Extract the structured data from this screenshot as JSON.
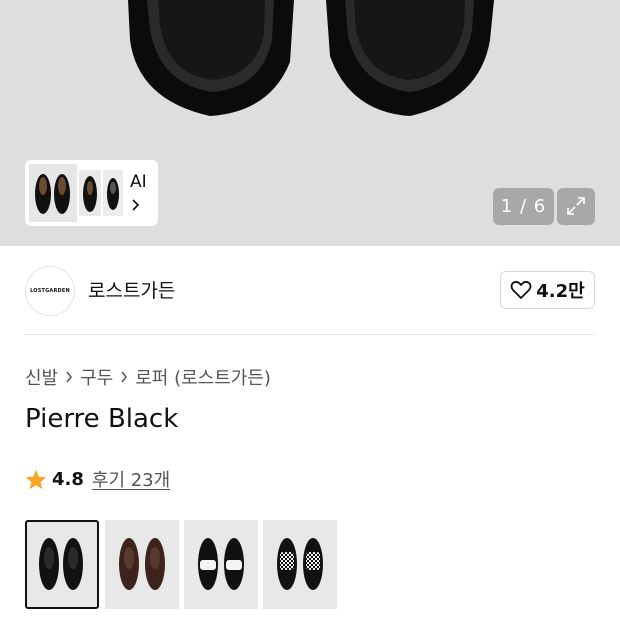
{
  "gallery": {
    "ai_label": "AI",
    "counter": "1 / 6"
  },
  "brand": {
    "logo_text": "LOSTGARDEN",
    "name": "로스트가든",
    "like_count": "4.2만"
  },
  "breadcrumb": [
    "신발",
    "구두",
    "로퍼 (로스트가든)"
  ],
  "product": {
    "title": "Pierre Black",
    "rating": "4.8",
    "reviews_label": "후기 23개"
  },
  "color_options": [
    {
      "name": "black",
      "color": "#111111",
      "selected": true
    },
    {
      "name": "brown",
      "color": "#4a2c22",
      "selected": false
    },
    {
      "name": "black-white",
      "color": "#111111",
      "selected": false
    },
    {
      "name": "checkerboard",
      "color": "#111111",
      "selected": false
    }
  ],
  "colors": {
    "star": "#f7a523",
    "hero_bg": "#dedede"
  },
  "icons": {
    "ai_chevron": "chevron-right-icon",
    "expand": "expand-icon",
    "like": "heart-icon",
    "breadcrumb_sep": "chevron-right-icon",
    "rating": "star-icon"
  }
}
